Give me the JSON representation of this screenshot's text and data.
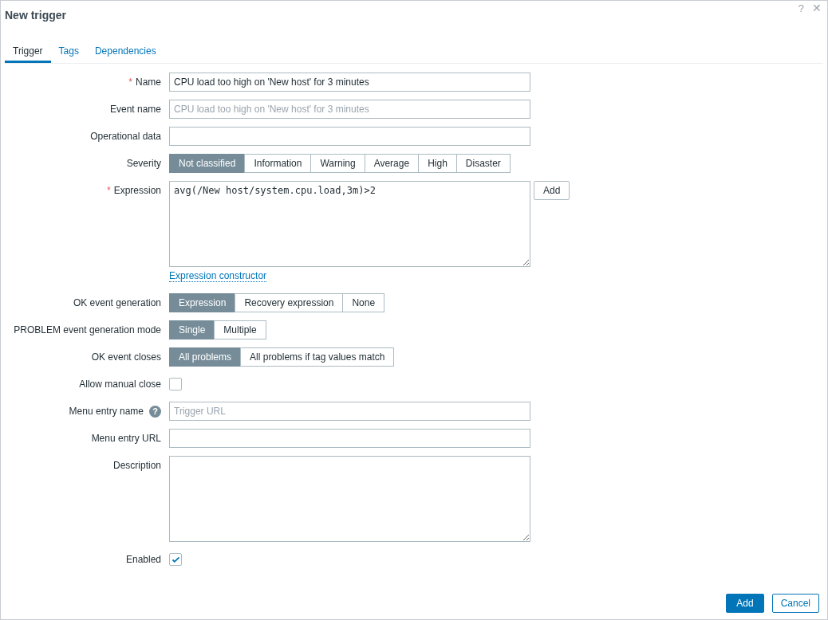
{
  "window": {
    "title": "New trigger",
    "help": "?",
    "close": "✕"
  },
  "tabs": [
    {
      "label": "Trigger",
      "selected": true
    },
    {
      "label": "Tags",
      "selected": false
    },
    {
      "label": "Dependencies",
      "selected": false
    }
  ],
  "form": [
    {
      "kind": "text",
      "label": "Name",
      "required_mark": "*",
      "value": "CPU load too high on 'New host' for 3 minutes"
    },
    {
      "kind": "text",
      "label": "Event name",
      "placeholder": "CPU load too high on 'New host' for 3 minutes"
    },
    {
      "kind": "text",
      "label": "Operational data"
    },
    {
      "kind": "segmented",
      "label": "Severity",
      "options": [
        {
          "label": "Not classified",
          "selected": true
        },
        {
          "label": "Information",
          "selected": false
        },
        {
          "label": "Warning",
          "selected": false
        },
        {
          "label": "Average",
          "selected": false
        },
        {
          "label": "High",
          "selected": false
        },
        {
          "label": "Disaster",
          "selected": false
        }
      ]
    },
    {
      "kind": "expression",
      "label": "Expression",
      "required_mark": "*",
      "value": "avg(/New host/system.cpu.load,3m)>2",
      "button": "Add",
      "link": "Expression constructor"
    },
    {
      "kind": "segmented",
      "label": "OK event generation",
      "options": [
        {
          "label": "Expression",
          "selected": true
        },
        {
          "label": "Recovery expression",
          "selected": false
        },
        {
          "label": "None",
          "selected": false
        }
      ]
    },
    {
      "kind": "segmented",
      "label": "PROBLEM event generation mode",
      "options": [
        {
          "label": "Single",
          "selected": true
        },
        {
          "label": "Multiple",
          "selected": false
        }
      ]
    },
    {
      "kind": "segmented",
      "label": "OK event closes",
      "options": [
        {
          "label": "All problems",
          "selected": true
        },
        {
          "label": "All problems if tag values match",
          "selected": false
        }
      ]
    },
    {
      "kind": "checkbox",
      "label": "Allow manual close",
      "checked": false
    },
    {
      "kind": "text",
      "label": "Menu entry name",
      "help": "?",
      "placeholder": "Trigger URL"
    },
    {
      "kind": "text",
      "label": "Menu entry URL"
    },
    {
      "kind": "textarea",
      "label": "Description"
    },
    {
      "kind": "checkbox",
      "label": "Enabled",
      "checked": true
    }
  ],
  "footer": {
    "buttons": [
      {
        "label": "Add",
        "primary": true
      },
      {
        "label": "Cancel",
        "primary": false
      }
    ]
  }
}
